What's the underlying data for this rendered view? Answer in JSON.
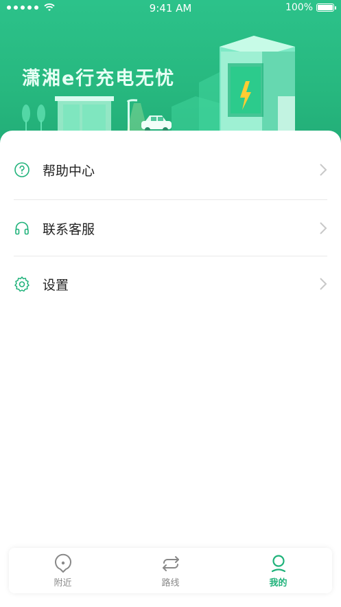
{
  "status_bar": {
    "time": "9:41 AM",
    "battery": "100%"
  },
  "hero": {
    "slogan": "潇湘e行充电无忧"
  },
  "menu": [
    {
      "label": "帮助中心",
      "icon": "question-circle-icon"
    },
    {
      "label": "联系客服",
      "icon": "headphones-icon"
    },
    {
      "label": "设置",
      "icon": "gear-icon"
    }
  ],
  "tabs": [
    {
      "label": "附近",
      "icon": "location-pin-icon",
      "active": false
    },
    {
      "label": "路线",
      "icon": "route-arrows-icon",
      "active": false
    },
    {
      "label": "我的",
      "icon": "user-icon",
      "active": true
    }
  ],
  "colors": {
    "accent": "#1fb27a",
    "hero": "#27b87f",
    "inactive": "#888888"
  }
}
